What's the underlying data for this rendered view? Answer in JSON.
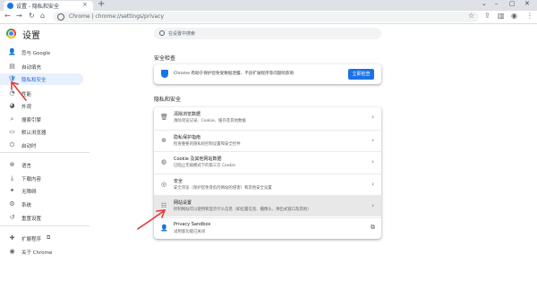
{
  "browser": {
    "tab_title": "设置 - 隐私和安全",
    "url": "Chrome  |  chrome://settings/privacy",
    "accent": "#1a73e8"
  },
  "sidebar": {
    "title": "设置",
    "items": [
      {
        "label": "您与 Google",
        "icon": "person-icon",
        "glyph": "👤"
      },
      {
        "label": "自动填充",
        "icon": "autofill-icon",
        "glyph": "▤"
      },
      {
        "label": "隐私和安全",
        "icon": "shield-icon",
        "glyph": "🛡",
        "active": true
      },
      {
        "label": "性能",
        "icon": "speedometer-icon",
        "glyph": "◔"
      },
      {
        "label": "外观",
        "icon": "palette-icon",
        "glyph": "◕"
      },
      {
        "label": "搜索引擎",
        "icon": "search-icon",
        "glyph": "⌕"
      },
      {
        "label": "默认浏览器",
        "icon": "browser-icon",
        "glyph": "▭"
      },
      {
        "label": "启动时",
        "icon": "power-icon",
        "glyph": "⏻"
      },
      {
        "label": "语言",
        "icon": "globe-icon",
        "glyph": "⊕"
      },
      {
        "label": "下载内容",
        "icon": "download-icon",
        "glyph": "⤓"
      },
      {
        "label": "无障碍",
        "icon": "accessibility-icon",
        "glyph": "✦"
      },
      {
        "label": "系统",
        "icon": "wrench-icon",
        "glyph": "⚙"
      },
      {
        "label": "重置设置",
        "icon": "reset-icon",
        "glyph": "↺"
      },
      {
        "label": "扩展程序",
        "icon": "puzzle-icon",
        "glyph": "✚"
      },
      {
        "label": "关于 Chrome",
        "icon": "chrome-icon",
        "glyph": "◉"
      }
    ]
  },
  "search": {
    "placeholder": "在设置中搜索"
  },
  "safety_check": {
    "heading": "安全检查",
    "text": "Chrome 有助于保护您免受数据泄露、不良扩展程序等问题的影响",
    "button": "立即检查"
  },
  "privacy": {
    "heading": "隐私和安全",
    "rows": [
      {
        "title": "清除浏览数据",
        "subtitle": "清除浏览记录、Cookie、缓存及其他数据",
        "icon": "trash-icon",
        "glyph": "🗑",
        "trail": "›"
      },
      {
        "title": "隐私保护指南",
        "subtitle": "检查重要的隐私权控制设置和安全控件",
        "icon": "privacy-guide-icon",
        "glyph": "⊕",
        "trail": "›"
      },
      {
        "title": "Cookie 及其他网站数据",
        "subtitle": "已阻止无痕模式下的第三方 Cookie",
        "icon": "cookie-icon",
        "glyph": "◍",
        "trail": "›"
      },
      {
        "title": "安全",
        "subtitle": "安全浏览（保护您免受危险网站的侵害）和其他安全设置",
        "icon": "shield-icon",
        "glyph": "◎",
        "trail": "›"
      },
      {
        "title": "网站设置",
        "subtitle": "控制网站可以使用和显示什么信息（如位置信息、摄像头、弹出式窗口及其他）",
        "icon": "site-settings-icon",
        "glyph": "☷",
        "trail": "›"
      },
      {
        "title": "Privacy Sandbox",
        "subtitle": "试用版功能已关闭",
        "icon": "flask-icon",
        "glyph": "👤",
        "trail": "⧉"
      }
    ]
  }
}
